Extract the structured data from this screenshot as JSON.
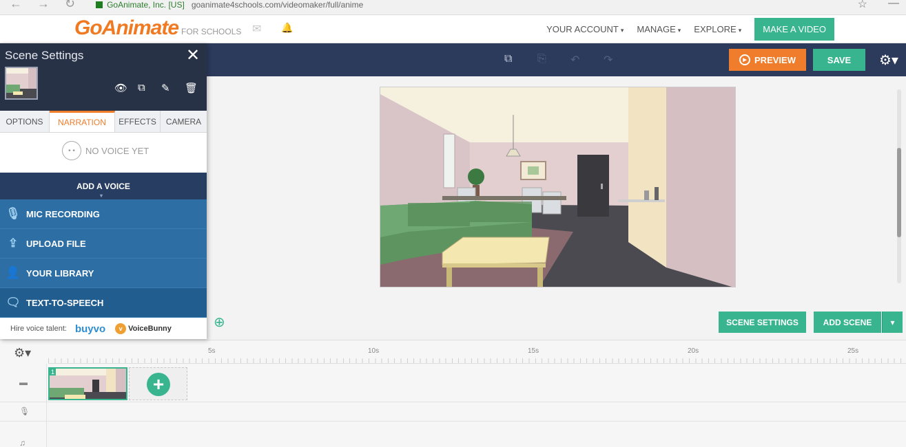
{
  "browser": {
    "back_icon": "←",
    "forward_icon": "→",
    "reload_icon": "↻",
    "site_label": "GoAnimate, Inc. [US]",
    "url": "goanimate4schools.com/videomaker/full/anime",
    "star_icon": "☆",
    "minimize_icon": "—"
  },
  "header": {
    "logo": "GoAnimate",
    "logo_sub": "FOR SCHOOLS",
    "mail_icon": "✉",
    "bell_icon": "🔔",
    "nav": {
      "account": "YOUR ACCOUNT",
      "manage": "MANAGE",
      "explore": "EXPLORE",
      "caret": "▾"
    },
    "make_video": "MAKE A VIDEO"
  },
  "toolbar": {
    "copy_icon": "⧉",
    "paste_icon": "⎘",
    "undo_icon": "↶",
    "redo_icon": "↷",
    "preview": "PREVIEW",
    "play_icon": "▶",
    "save": "SAVE",
    "gear_icon": "⚙▾"
  },
  "panel": {
    "title": "Scene Settings",
    "close_icon": "✕",
    "tool_icons": {
      "eye": "👁",
      "copy": "⧉",
      "brush": "✎",
      "trash": "🗑"
    },
    "tabs": [
      "OPTIONS",
      "NARRATION",
      "EFFECTS",
      "CAMERA"
    ],
    "no_voice": "NO VOICE YET",
    "face_icon": "• •",
    "add_voice": "ADD A VOICE",
    "add_voice_caret": "▾",
    "options": [
      {
        "label": "MIC RECORDING",
        "icon": "🎙"
      },
      {
        "label": "UPLOAD FILE",
        "icon": "⇪"
      },
      {
        "label": "YOUR LIBRARY",
        "icon": "👤"
      },
      {
        "label": "TEXT-TO-SPEECH",
        "icon": "🗨"
      }
    ],
    "hire_label": "Hire voice talent:",
    "buyvo": "buyvo",
    "voicebunny": "VoiceBunny",
    "voicebunny_badge": "v"
  },
  "stage": {
    "zoom_icon": "⊕",
    "scene_settings": "SCENE SETTINGS",
    "add_scene": "ADD SCENE",
    "add_scene_caret": "▾"
  },
  "timeline": {
    "gear_icon": "⚙▾",
    "ticks": [
      "5s",
      "10s",
      "15s",
      "20s",
      "25s"
    ],
    "scene_number": "1",
    "add_icon": "+",
    "video_icon": "▬",
    "mic_icon": "🎙",
    "music_icon": "♫"
  },
  "colors": {
    "accent_green": "#38b58f",
    "preview_orange": "#ef7d2c",
    "toolbar_navy": "#2c3a5c",
    "panel_blue": "#2d6fa5"
  }
}
